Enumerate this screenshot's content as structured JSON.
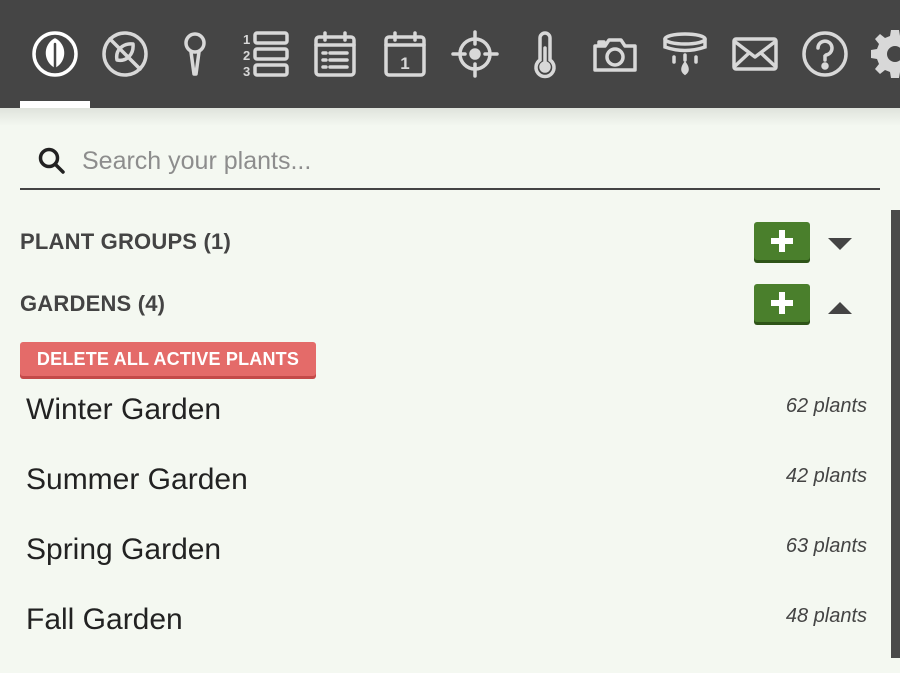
{
  "nav": {
    "items": [
      {
        "icon": "leaf-icon"
      },
      {
        "icon": "no-plant-icon"
      },
      {
        "icon": "location-pin-icon"
      },
      {
        "icon": "numbered-list-icon"
      },
      {
        "icon": "calendar-list-icon"
      },
      {
        "icon": "calendar-day-icon",
        "label": "1"
      },
      {
        "icon": "crosshair-icon"
      },
      {
        "icon": "thermometer-icon"
      },
      {
        "icon": "camera-icon"
      },
      {
        "icon": "sprinkler-icon"
      },
      {
        "icon": "mail-icon"
      },
      {
        "icon": "help-icon"
      },
      {
        "icon": "gear-icon"
      }
    ]
  },
  "search": {
    "placeholder": "Search your plants..."
  },
  "sections": {
    "plant_groups": {
      "title": "PLANT GROUPS (1)",
      "expanded": false
    },
    "gardens": {
      "title": "GARDENS (4)",
      "expanded": true
    }
  },
  "delete_button": {
    "label": "DELETE ALL ACTIVE PLANTS"
  },
  "gardens": [
    {
      "name": "Winter Garden",
      "count": "62 plants"
    },
    {
      "name": "Summer Garden",
      "count": "42 plants"
    },
    {
      "name": "Spring Garden",
      "count": "63 plants"
    },
    {
      "name": "Fall Garden",
      "count": "48 plants"
    }
  ],
  "colors": {
    "nav_bg": "#454545",
    "page_bg": "#f4f8f1",
    "add_green": "#4a7f2c",
    "delete_red": "#e46b69"
  }
}
